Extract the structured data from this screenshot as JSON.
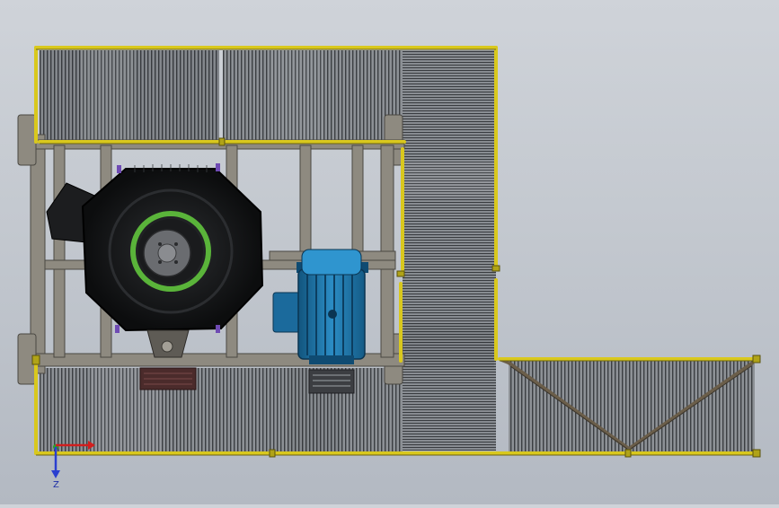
{
  "viewport": {
    "view": "top",
    "background": [
      "#cfd3d9",
      "#b3b9c2"
    ]
  },
  "model": {
    "parts": [
      "steel-frame",
      "guard-rail",
      "grating-panel",
      "crusher-rotor",
      "electric-motor",
      "hopper"
    ],
    "colors": {
      "rail": "#d9c81d",
      "frame": "#8e8a80",
      "grating": "#6d7176",
      "motor": "#1e74a8",
      "rotor_ring": "#5ab43a",
      "rotor_body": "#151618"
    }
  },
  "triad": {
    "axis_x_label": "",
    "axis_z_label": "Z",
    "x_color": "#d21e1e",
    "z_color": "#2a3fd0",
    "origin_color": "#2aa02a"
  }
}
